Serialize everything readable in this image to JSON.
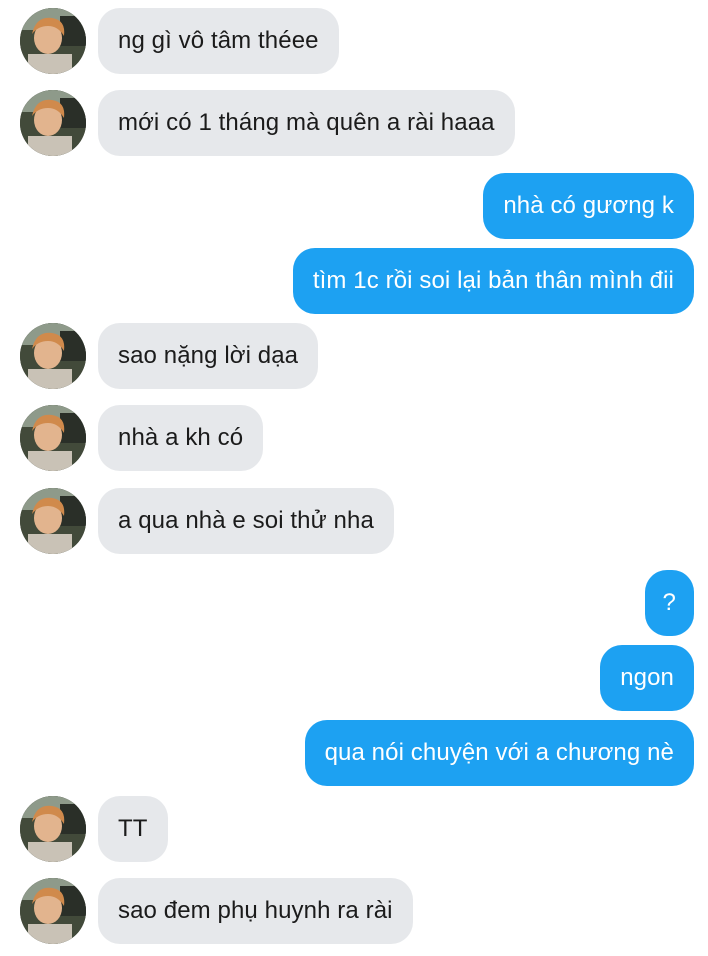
{
  "conversation": {
    "messages": [
      {
        "sender": "other",
        "text": "ng gì vô tâm théee"
      },
      {
        "sender": "other",
        "text": "mới có 1 tháng mà quên a rài haaa"
      },
      {
        "sender": "me",
        "text": "nhà có gương k"
      },
      {
        "sender": "me",
        "text": "tìm 1c rồi soi lại bản thân mình đii"
      },
      {
        "sender": "other",
        "text": "sao nặng lời dạa"
      },
      {
        "sender": "other",
        "text": "nhà a kh có"
      },
      {
        "sender": "other",
        "text": "a qua nhà e soi thử nha"
      },
      {
        "sender": "me",
        "text": "?"
      },
      {
        "sender": "me",
        "text": "ngon"
      },
      {
        "sender": "me",
        "text": "qua nói chuyện với a chương nè"
      },
      {
        "sender": "other",
        "text": "TT"
      },
      {
        "sender": "other",
        "text": "sao đem phụ huynh ra rài"
      }
    ]
  },
  "colors": {
    "incoming_bubble": "#e6e8eb",
    "outgoing_bubble": "#1da1f2",
    "incoming_text": "#1b1b1b",
    "outgoing_text": "#ffffff"
  },
  "icons": {
    "avatar": "profile-photo"
  }
}
